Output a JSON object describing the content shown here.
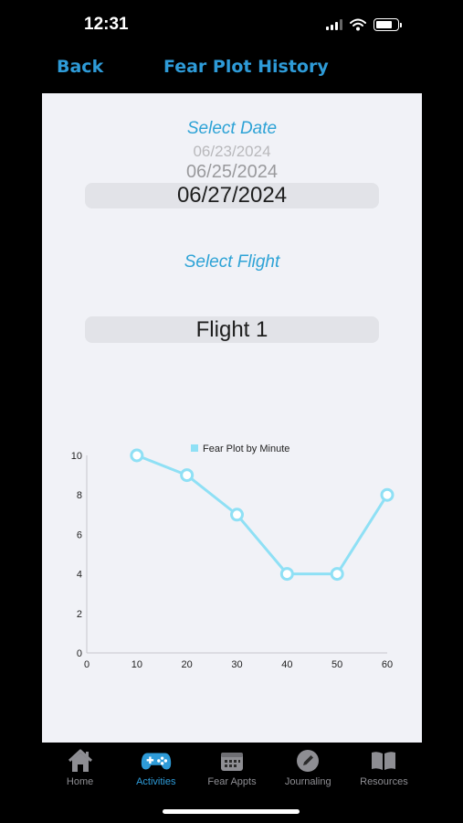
{
  "status_bar": {
    "time": "12:31"
  },
  "nav": {
    "back_label": "Back",
    "title": "Fear Plot History"
  },
  "date_picker": {
    "label": "Select Date",
    "faded_far": "06/23/2024",
    "faded_near": "06/25/2024",
    "selected": "06/27/2024"
  },
  "flight_picker": {
    "label": "Select Flight",
    "selected": "Flight 1"
  },
  "chart_data": {
    "type": "line",
    "legend": "Fear Plot by Minute",
    "legend_position": "top-center",
    "x": [
      10,
      20,
      30,
      40,
      50,
      60
    ],
    "series": [
      {
        "name": "Fear Plot by Minute",
        "values": [
          10,
          9,
          7,
          4,
          4,
          8
        ]
      }
    ],
    "xlim": [
      0,
      60
    ],
    "ylim": [
      0,
      10
    ],
    "x_ticks": [
      0,
      10,
      20,
      30,
      40,
      50,
      60
    ],
    "y_ticks": [
      0,
      2,
      4,
      6,
      8,
      10
    ],
    "grid": false,
    "series_color": "#8fe0f5"
  },
  "tabs": [
    {
      "label": "Home",
      "icon": "home-icon",
      "active": false
    },
    {
      "label": "Activities",
      "icon": "gamepad-icon",
      "active": true
    },
    {
      "label": "Fear Appts",
      "icon": "calendar-icon",
      "active": false
    },
    {
      "label": "Journaling",
      "icon": "pencil-icon",
      "active": false
    },
    {
      "label": "Resources",
      "icon": "book-icon",
      "active": false
    }
  ],
  "colors": {
    "accent": "#2e9bd8",
    "tab_inactive": "#8e8e93",
    "panel": "#f1f2f7"
  }
}
